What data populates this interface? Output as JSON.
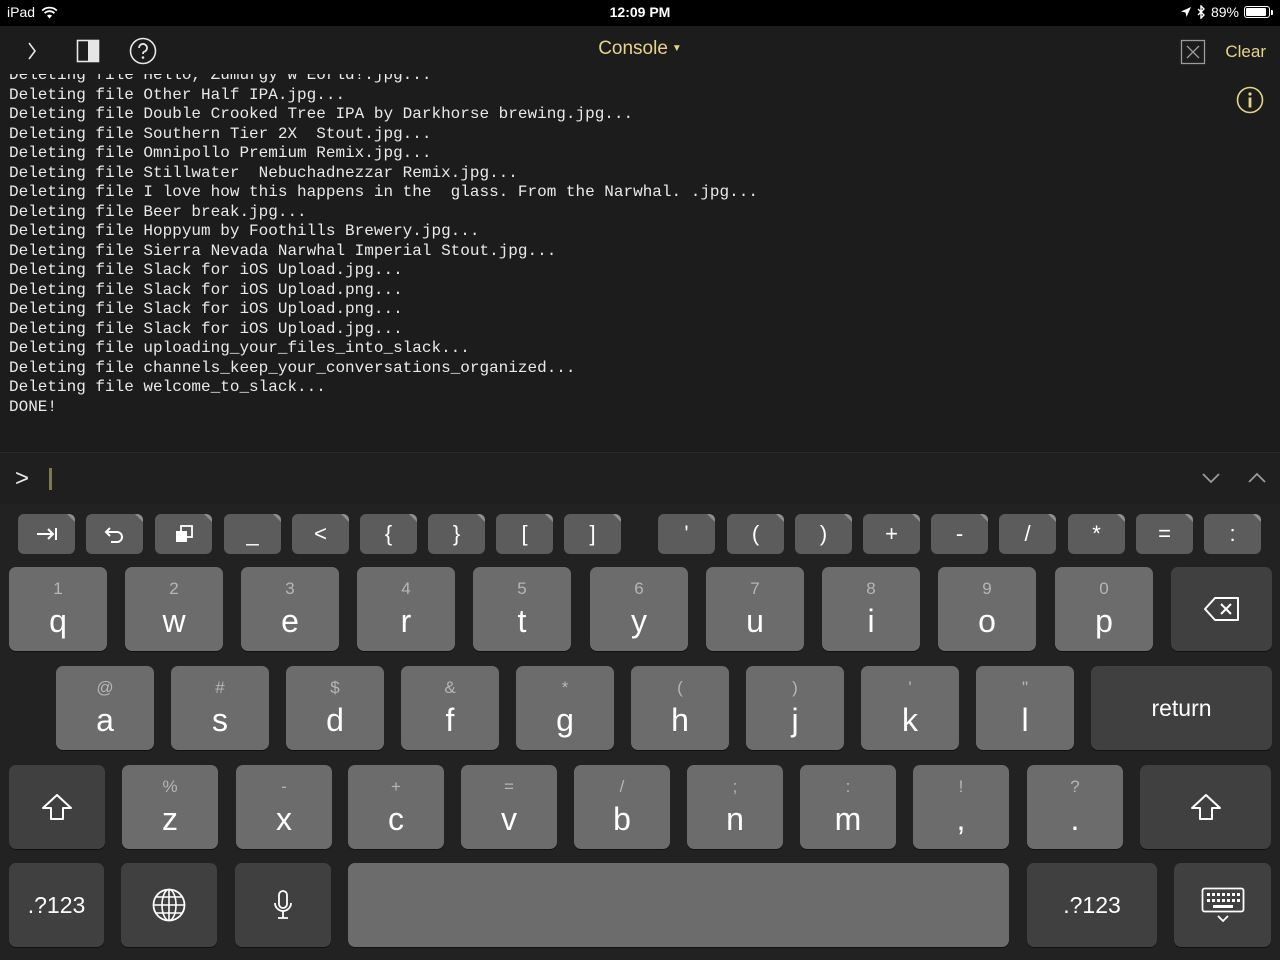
{
  "status_bar": {
    "device": "iPad",
    "time": "12:09 PM",
    "battery": "89%",
    "battery_level": 0.89
  },
  "nav": {
    "title": "Console",
    "clear_label": "Clear"
  },
  "console": {
    "lines": [
      "Deleting file Hello, Zumurgy w'Eorld!.jpg...",
      "Deleting file Other Half IPA.jpg...",
      "Deleting file Double Crooked Tree IPA by Darkhorse brewing.jpg...",
      "Deleting file Southern Tier 2X  Stout.jpg...",
      "Deleting file Omnipollo Premium Remix.jpg...",
      "Deleting file Stillwater  Nebuchadnezzar Remix.jpg...",
      "Deleting file I love how this happens in the  glass. From the Narwhal. .jpg...",
      "Deleting file Beer break.jpg...",
      "Deleting file Hoppyum by Foothills Brewery.jpg...",
      "Deleting file Sierra Nevada Narwhal Imperial Stout.jpg...",
      "Deleting file Slack for iOS Upload.jpg...",
      "Deleting file Slack for iOS Upload.png...",
      "Deleting file Slack for iOS Upload.png...",
      "Deleting file Slack for iOS Upload.jpg...",
      "Deleting file uploading_your_files_into_slack...",
      "Deleting file channels_keep_your_conversations_organized...",
      "Deleting file welcome_to_slack...",
      "DONE!"
    ]
  },
  "prompt": {
    "sign": ">"
  },
  "shortcut_keys": [
    "_",
    "<",
    "{",
    "}",
    "[",
    "]",
    "'",
    "(",
    ")",
    "+",
    "-",
    "/",
    "*",
    "=",
    ":"
  ],
  "keyboard": {
    "row1": [
      {
        "hint": "1",
        "key": "q"
      },
      {
        "hint": "2",
        "key": "w"
      },
      {
        "hint": "3",
        "key": "e"
      },
      {
        "hint": "4",
        "key": "r"
      },
      {
        "hint": "5",
        "key": "t"
      },
      {
        "hint": "6",
        "key": "y"
      },
      {
        "hint": "7",
        "key": "u"
      },
      {
        "hint": "8",
        "key": "i"
      },
      {
        "hint": "9",
        "key": "o"
      },
      {
        "hint": "0",
        "key": "p"
      }
    ],
    "row2": [
      {
        "hint": "@",
        "key": "a"
      },
      {
        "hint": "#",
        "key": "s"
      },
      {
        "hint": "$",
        "key": "d"
      },
      {
        "hint": "&",
        "key": "f"
      },
      {
        "hint": "*",
        "key": "g"
      },
      {
        "hint": "(",
        "key": "h"
      },
      {
        "hint": ")",
        "key": "j"
      },
      {
        "hint": "'",
        "key": "k"
      },
      {
        "hint": "\"",
        "key": "l"
      }
    ],
    "row3": [
      {
        "hint": "%",
        "key": "z"
      },
      {
        "hint": "-",
        "key": "x"
      },
      {
        "hint": "+",
        "key": "c"
      },
      {
        "hint": "=",
        "key": "v"
      },
      {
        "hint": "/",
        "key": "b"
      },
      {
        "hint": ";",
        "key": "n"
      },
      {
        "hint": ":",
        "key": "m"
      },
      {
        "hint": "!",
        "key": ","
      },
      {
        "hint": "?",
        "key": "."
      }
    ],
    "return_label": "return",
    "numbers_label": ".?123"
  },
  "colors": {
    "accent": "#e6d38a",
    "key": "#6c6c6c",
    "key_dark": "#404040",
    "background": "#1c1c1c"
  }
}
